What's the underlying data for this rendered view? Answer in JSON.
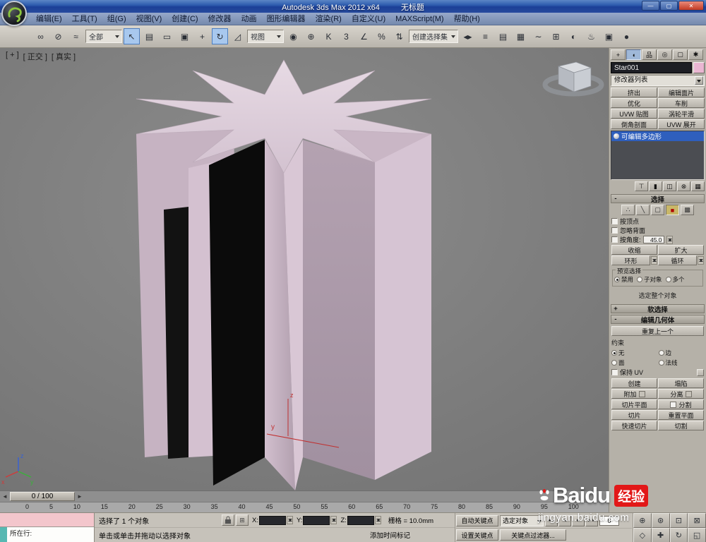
{
  "colors": {
    "titlebar_blue": "#1b3f97",
    "selection_blue": "#2f5fbd",
    "object_pink": "#d9c7d5",
    "object_swatch_pink": "#eab6d2",
    "panel_gray": "#b5b1a8",
    "viewport_gray": "#7e7e7e",
    "watermark_red": "#e21818"
  },
  "window": {
    "title": "Autodesk 3ds Max  2012 x64",
    "doc_title": "无标题",
    "min_label": "—",
    "max_label": "▢",
    "close_label": "✕"
  },
  "menu": {
    "items": [
      {
        "name": "menu-edit",
        "label": "编辑(E)"
      },
      {
        "name": "menu-tools",
        "label": "工具(T)"
      },
      {
        "name": "menu-group",
        "label": "组(G)"
      },
      {
        "name": "menu-views",
        "label": "视图(V)"
      },
      {
        "name": "menu-create",
        "label": "创建(C)"
      },
      {
        "name": "menu-modifiers",
        "label": "修改器"
      },
      {
        "name": "menu-animation",
        "label": "动画"
      },
      {
        "name": "menu-graph-editors",
        "label": "图形编辑器"
      },
      {
        "name": "menu-rendering",
        "label": "渲染(R)"
      },
      {
        "name": "menu-customize",
        "label": "自定义(U)"
      },
      {
        "name": "menu-maxscript",
        "label": "MAXScript(M)"
      },
      {
        "name": "menu-help",
        "label": "帮助(H)"
      }
    ]
  },
  "toolbar": {
    "items": [
      {
        "name": "select-and-link-button",
        "glyph": "∞"
      },
      {
        "name": "unlink-selection-button",
        "glyph": "⊘"
      },
      {
        "name": "bind-to-space-warp-button",
        "glyph": "≈"
      },
      {
        "name": "selection-filter-dropdown",
        "type": "dropdown",
        "label": "全部"
      },
      {
        "name": "select-object-button",
        "glyph": "↖",
        "active": true
      },
      {
        "name": "select-by-name-button",
        "glyph": "▤"
      },
      {
        "name": "rectangular-selection-region-button",
        "glyph": "▭"
      },
      {
        "name": "window-crossing-toggle-button",
        "glyph": "▣"
      },
      {
        "name": "select-and-move-button",
        "glyph": "+"
      },
      {
        "name": "select-and-rotate-button",
        "glyph": "↻",
        "active": true
      },
      {
        "name": "select-and-scale-button",
        "glyph": "◿"
      },
      {
        "name": "reference-coordinate-dropdown",
        "type": "dropdown",
        "label": "视图"
      },
      {
        "name": "use-pivot-point-center-button",
        "glyph": "◉"
      },
      {
        "name": "select-and-manipulate-button",
        "glyph": "⊕"
      },
      {
        "name": "keyboard-shortcut-override-button",
        "glyph": "K"
      },
      {
        "name": "snap-toggle-3d-button",
        "glyph": "3"
      },
      {
        "name": "angle-snap-button",
        "glyph": "∠"
      },
      {
        "name": "percent-snap-button",
        "glyph": "%"
      },
      {
        "name": "spinner-snap-button",
        "glyph": "⇅"
      },
      {
        "name": "named-selection-sets-dropdown",
        "type": "dropdown",
        "label": "创建选择集"
      },
      {
        "name": "mirror-button",
        "glyph": "◂▸"
      },
      {
        "name": "align-button",
        "glyph": "≡"
      },
      {
        "name": "manage-layers-button",
        "glyph": "▤"
      },
      {
        "name": "graphite-modeling-toolbar-button",
        "glyph": "▦"
      },
      {
        "name": "curve-editor-button",
        "glyph": "∼"
      },
      {
        "name": "schedule-view-button",
        "glyph": "⊞"
      },
      {
        "name": "material-editor-button",
        "glyph": "◐"
      },
      {
        "name": "render-setup-button",
        "glyph": "♨"
      },
      {
        "name": "rendered-frame-window-button",
        "glyph": "▣"
      },
      {
        "name": "render-production-button",
        "glyph": "●"
      }
    ]
  },
  "viewport": {
    "label_plus": "[ + ]",
    "label_view": "[ 正交 ]",
    "label_shading": "[ 真实 ]",
    "gizmo_y": "y",
    "gizmo_z": "z",
    "axis_x": "x",
    "axis_y": "y",
    "axis_z": "z"
  },
  "command_panel": {
    "tabs": [
      {
        "name": "create-tab",
        "glyph": "+"
      },
      {
        "name": "modify-tab",
        "glyph": "◖",
        "active": true
      },
      {
        "name": "hierarchy-tab",
        "glyph": "品"
      },
      {
        "name": "motion-tab",
        "glyph": "◎"
      },
      {
        "name": "display-tab",
        "glyph": "▢"
      },
      {
        "name": "utilities-tab",
        "glyph": "✱"
      }
    ],
    "object_name": "Star001",
    "modifier_list_label": "修改器列表",
    "modifier_buttons": [
      {
        "name": "modifier-extrude-button",
        "label": "挤出"
      },
      {
        "name": "modifier-edit-patch-button",
        "label": "编辑面片"
      },
      {
        "name": "modifier-optimize-button",
        "label": "优化"
      },
      {
        "name": "modifier-lathe-button",
        "label": "车削"
      },
      {
        "name": "modifier-uvw-map-button",
        "label": "UVW 贴图"
      },
      {
        "name": "modifier-turbosmooth-button",
        "label": "涡轮平滑"
      },
      {
        "name": "modifier-bevel-profile-button",
        "label": "倒角剖面"
      },
      {
        "name": "modifier-unwrap-uvw-button",
        "label": "UVW 展开"
      }
    ],
    "stack_selected": "可编辑多边形",
    "stack_tools": [
      {
        "name": "pin-stack-button",
        "glyph": "⊤"
      },
      {
        "name": "show-end-result-button",
        "glyph": "▮"
      },
      {
        "name": "make-unique-button",
        "glyph": "◫"
      },
      {
        "name": "remove-modifier-button",
        "glyph": "⊗"
      },
      {
        "name": "configure-modifier-sets-button",
        "glyph": "▦"
      }
    ],
    "selection": {
      "state": "-",
      "title": "选择",
      "subobject": [
        {
          "name": "vertex-subobject-icon",
          "glyph": "∴"
        },
        {
          "name": "edge-subobject-icon",
          "glyph": "╲"
        },
        {
          "name": "border-subobject-icon",
          "glyph": "▢"
        },
        {
          "name": "polygon-subobject-icon",
          "glyph": "■",
          "active": true
        },
        {
          "name": "element-subobject-icon",
          "glyph": "▩"
        }
      ],
      "by_vertex": "按顶点",
      "ignore_backfacing": "忽略背面",
      "by_angle": "按角度:",
      "angle_value": "45.0",
      "shrink": "收缩",
      "grow": "扩大",
      "ring": "环形",
      "loop": "循环",
      "preview_title": "预览选择",
      "preview_options": [
        {
          "name": "preview-disable-radio",
          "label": "禁用",
          "on": true
        },
        {
          "name": "preview-subobject-radio",
          "label": "子对象"
        },
        {
          "name": "preview-multiple-radio",
          "label": "多个"
        }
      ],
      "whole_object_status": "选定整个对象"
    },
    "soft_selection": {
      "state": "+",
      "title": "软选择"
    },
    "edit_geometry": {
      "state": "-",
      "title": "编辑几何体",
      "repeat_last": "重复上一个",
      "constraints_label": "约束",
      "constraints": [
        {
          "name": "constraint-none-radio",
          "label": "无",
          "on": true
        },
        {
          "name": "constraint-edge-radio",
          "label": "边"
        },
        {
          "name": "constraint-face-radio",
          "label": "面"
        },
        {
          "name": "constraint-normal-radio",
          "label": "法线"
        }
      ],
      "preserve_uv": "保持 UV",
      "buttons": [
        {
          "name": "create-button",
          "label": "创建"
        },
        {
          "name": "collapse-button",
          "label": "塌陷"
        },
        {
          "name": "attach-button",
          "label": "附加",
          "mini": true
        },
        {
          "name": "detach-button",
          "label": "分离",
          "mini": true
        },
        {
          "name": "slice-plane-button",
          "label": "切片平面"
        },
        {
          "name": "split-checkbox",
          "label": "分割",
          "check": true
        },
        {
          "name": "slice-button",
          "label": "切片"
        },
        {
          "name": "reset-plane-button",
          "label": "重置平面"
        },
        {
          "name": "quickslice-button",
          "label": "快速切片"
        },
        {
          "name": "cut-button",
          "label": "切割"
        }
      ]
    }
  },
  "timeline": {
    "slider_label": "0 / 100",
    "prev_arrow": "◄",
    "next_arrow": "►",
    "ticks": [
      "0",
      "5",
      "10",
      "15",
      "20",
      "25",
      "30",
      "35",
      "40",
      "45",
      "50",
      "55",
      "60",
      "65",
      "70",
      "75",
      "80",
      "85",
      "90",
      "95",
      "100"
    ]
  },
  "status_bar": {
    "listener_label": "所在行:",
    "status": "选择了 1 个对象",
    "prompt": "单击或单击并拖动以选择对象",
    "x_label": "X:",
    "y_label": "Y:",
    "z_label": "Z:",
    "x_value": "",
    "y_value": "",
    "z_value": "",
    "grid": "栅格 = 10.0mm",
    "time_tag": "添加时间标记",
    "auto_key": "自动关键点",
    "set_key": "设置关键点",
    "selected_filter": "选定对象",
    "key_filters": "关键点过滤器...",
    "frame_value": "0",
    "playback": [
      {
        "name": "go-to-start-button",
        "glyph": "◄◄"
      },
      {
        "name": "previous-frame-button",
        "glyph": "◄"
      },
      {
        "name": "play-button",
        "glyph": "►"
      },
      {
        "name": "go-to-end-button",
        "glyph": "►►"
      }
    ],
    "nav": [
      {
        "name": "zoom-button",
        "glyph": "⊕"
      },
      {
        "name": "zoom-all-button",
        "glyph": "⊛"
      },
      {
        "name": "zoom-extents-button",
        "glyph": "⊡"
      },
      {
        "name": "zoom-region-button",
        "glyph": "⊠"
      },
      {
        "name": "field-of-view-button",
        "glyph": "◇"
      },
      {
        "name": "pan-button",
        "glyph": "✚"
      },
      {
        "name": "orbit-button",
        "glyph": "↻"
      },
      {
        "name": "maximize-viewport-button",
        "glyph": "◱"
      }
    ]
  },
  "watermark": {
    "brand": "Baidu",
    "badge": "经验",
    "url": "jingyan.baidu.com"
  }
}
